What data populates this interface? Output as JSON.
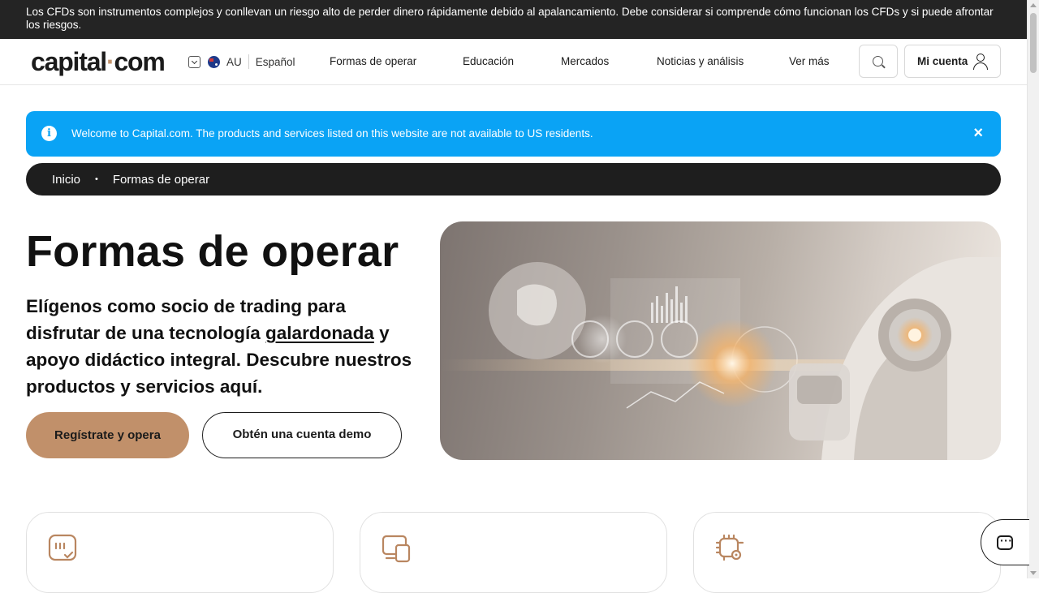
{
  "risk_warning": "Los CFDs son instrumentos complejos y conllevan un riesgo alto de perder dinero rápidamente debido al apalancamiento. Debe considerar si comprende cómo funcionan los CFDs y si puede afrontar los riesgos.",
  "header": {
    "logo_left": "capital",
    "logo_dot": "·",
    "logo_right": "com",
    "region_code": "AU",
    "language": "Español",
    "nav": [
      {
        "label": "Formas de operar"
      },
      {
        "label": "Educación"
      },
      {
        "label": "Mercados"
      },
      {
        "label": "Noticias y análisis"
      },
      {
        "label": "Ver más"
      }
    ],
    "account_label": "Mi cuenta"
  },
  "info_banner": {
    "text": "Welcome to Capital.com. The products and services listed on this website are not available to US residents.",
    "close": "×"
  },
  "breadcrumb": {
    "home": "Inicio",
    "separator": "•",
    "current": "Formas de operar"
  },
  "hero": {
    "title": "Formas de operar",
    "subtitle_before": "Elígenos como socio de trading para disfrutar de una tecnología ",
    "subtitle_link": "galardonada",
    "subtitle_after": " y apoyo didáctico integral. Descubre nuestros productos y servicios aquí.",
    "register_button": "Regístrate y opera",
    "demo_button": "Obtén una cuenta demo"
  },
  "colors": {
    "accent": "#c1906a",
    "info_blue": "#0aa3f5",
    "dark": "#1e1e1e"
  },
  "cards": [
    {
      "icon": "chat-check-icon"
    },
    {
      "icon": "devices-icon"
    },
    {
      "icon": "chip-gear-icon"
    }
  ]
}
